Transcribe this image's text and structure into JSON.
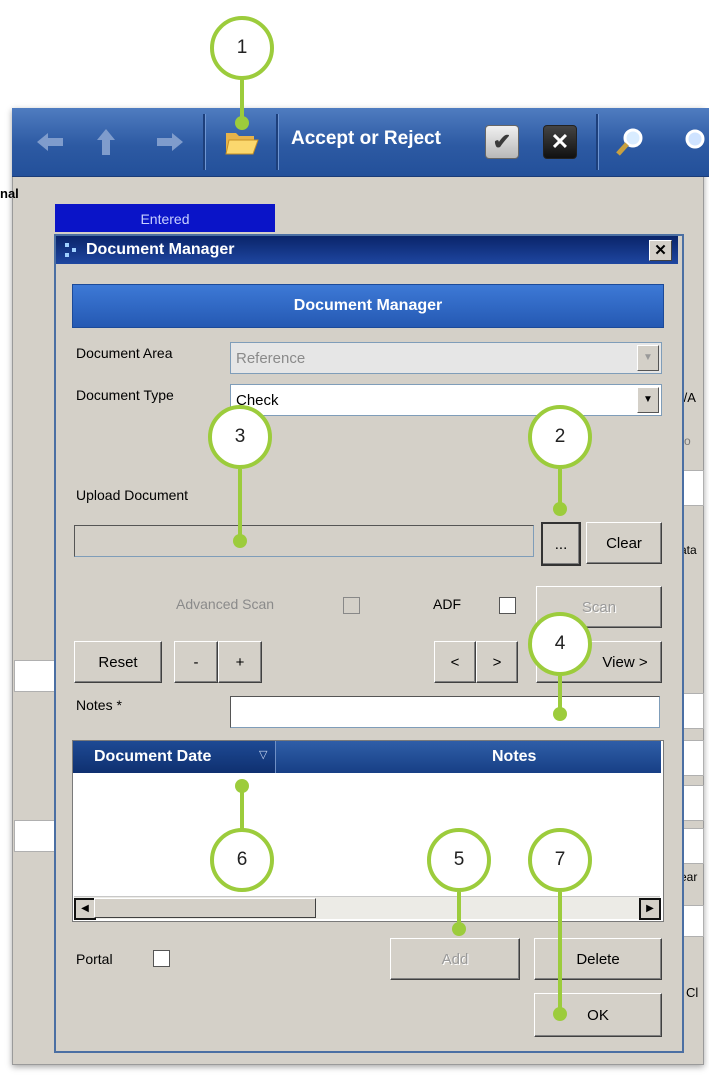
{
  "background_app": {
    "toolbar": {
      "back_icon": "back-arrow-icon",
      "up_icon": "up-arrow-icon",
      "forward_icon": "forward-arrow-icon",
      "folder_icon": "open-folder-icon",
      "accept_reject_label": "Accept or Reject",
      "accept_icon": "checkmark-icon",
      "reject_icon": "x-icon",
      "search_icon": "magnifier-icon"
    },
    "side_label": "nal",
    "status_cell": "Entered",
    "right_fragments": [
      "I/A",
      "o",
      "ata",
      "ear",
      "Cl"
    ]
  },
  "dialog": {
    "title": "Document Manager",
    "close_icon": "close-icon",
    "header": "Document Manager",
    "document_area": {
      "label": "Document Area",
      "value": "Reference"
    },
    "document_type": {
      "label": "Document Type",
      "value": "Check"
    },
    "upload": {
      "label": "Upload Document",
      "browse_label": "...",
      "clear_label": "Clear",
      "path_value": ""
    },
    "scan": {
      "advanced_label": "Advanced Scan",
      "adf_label": "ADF",
      "scan_label": "Scan"
    },
    "nav": {
      "reset_label": "Reset",
      "minus_label": "-",
      "plus_label": "+",
      "prev_label": "<",
      "next_label": ">",
      "view_label": "View >"
    },
    "notes": {
      "label": "Notes *",
      "value": ""
    },
    "grid": {
      "columns": [
        "Document Date",
        "Notes"
      ],
      "sort_icon": "sort-down-icon",
      "rows": []
    },
    "portal": {
      "label": "Portal"
    },
    "buttons": {
      "add_label": "Add",
      "delete_label": "Delete",
      "ok_label": "OK"
    }
  },
  "callouts": [
    "1",
    "2",
    "3",
    "4",
    "5",
    "6",
    "7"
  ],
  "colors": {
    "callout_green": "#9ccc3c",
    "toolbar_blue": "#2d5aa3",
    "titlebar_blue": "#0a246a",
    "status_blue": "#0a14c8"
  }
}
